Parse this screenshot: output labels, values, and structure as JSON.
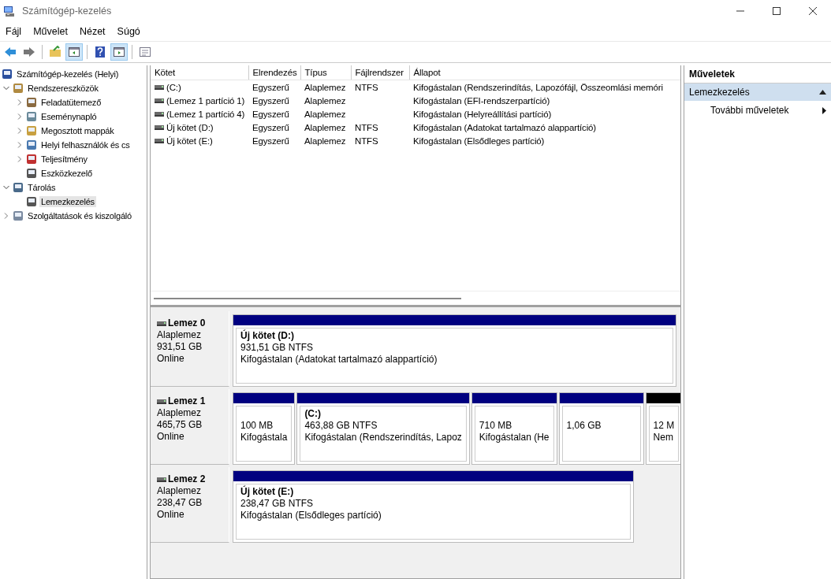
{
  "window": {
    "title": "Számítógép-kezelés"
  },
  "menu": [
    "Fájl",
    "Művelet",
    "Nézet",
    "Súgó"
  ],
  "toolbar": [
    {
      "kind": "back",
      "pressed": false
    },
    {
      "kind": "forward",
      "pressed": false
    },
    {
      "kind": "up",
      "pressed": false
    },
    {
      "kind": "tree",
      "pressed": true
    },
    {
      "kind": "help",
      "pressed": false
    },
    {
      "kind": "actions",
      "pressed": true
    },
    {
      "kind": "properties",
      "pressed": false
    }
  ],
  "tree": [
    {
      "label": "Számítógép-kezelés (Helyi)",
      "kind": "root",
      "selected": false,
      "children": [
        {
          "label": "Rendszereszközök",
          "kind": "folder",
          "expanded": true,
          "selected": false,
          "children": [
            {
              "label": "Feladatütemező",
              "kind": "folder",
              "expanded": false,
              "selected": false
            },
            {
              "label": "Eseménynapló",
              "kind": "folder",
              "expanded": false,
              "selected": false
            },
            {
              "label": "Megosztott mappák",
              "kind": "folder",
              "expanded": false,
              "selected": false
            },
            {
              "label": "Helyi felhasználók és cs",
              "kind": "folder",
              "expanded": false,
              "selected": false
            },
            {
              "label": "Teljesítmény",
              "kind": "folder",
              "expanded": false,
              "selected": false
            },
            {
              "label": "Eszközkezelő",
              "kind": "leaf",
              "selected": false
            }
          ]
        },
        {
          "label": "Tárolás",
          "kind": "folder",
          "expanded": true,
          "selected": false,
          "children": [
            {
              "label": "Lemezkezelés",
              "kind": "leaf",
              "selected": true
            }
          ]
        },
        {
          "label": "Szolgáltatások és kiszolgáló",
          "kind": "folder",
          "expanded": false,
          "selected": false
        }
      ]
    }
  ],
  "volumes": {
    "columns": [
      "Kötet",
      "Elrendezés",
      "Típus",
      "Fájlrendszer",
      "Állapot"
    ],
    "rows": [
      {
        "volume": " (C:)",
        "layout": "Egyszerű",
        "type": "Alaplemez",
        "filesystem": "NTFS",
        "status": "Kifogástalan (Rendszerindítás, Lapozófájl, Összeomlási memóri"
      },
      {
        "volume": "(Lemez 1 partíció 1)",
        "layout": "Egyszerű",
        "type": "Alaplemez",
        "status": "Kifogástalan (EFI-rendszerpartíció)"
      },
      {
        "volume": "(Lemez 1 partíció 4)",
        "layout": "Egyszerű",
        "type": "Alaplemez",
        "status": "Kifogástalan (Helyreállítási partíció)"
      },
      {
        "volume": "Új kötet (D:)",
        "layout": "Egyszerű",
        "type": "Alaplemez",
        "filesystem": "NTFS",
        "status": "Kifogástalan (Adatokat tartalmazó alappartíció)"
      },
      {
        "volume": "Új kötet (E:)",
        "layout": "Egyszerű",
        "type": "Alaplemez",
        "filesystem": "NTFS",
        "status": "Kifogástalan (Elsődleges partíció)"
      }
    ]
  },
  "disks": [
    {
      "name": "Lemez 0",
      "type": "Alaplemez",
      "size": "931,51 GB",
      "status": "Online",
      "partitions": [
        {
          "kind": "primary",
          "title": "Új kötet  (D:)",
          "size": "931,51 GB NTFS",
          "status": "Kifogástalan (Adatokat tartalmazó alappartíció)"
        }
      ]
    },
    {
      "name": "Lemez 1",
      "type": "Alaplemez",
      "size": "465,75 GB",
      "status": "Online",
      "partitions": [
        {
          "kind": "primary",
          "size": "100 MB",
          "status": "Kifogástala"
        },
        {
          "kind": "primary",
          "title": " (C:)",
          "size": "463,88 GB NTFS",
          "status": "Kifogástalan (Rendszerindítás, Lapoz"
        },
        {
          "kind": "primary",
          "size": "710 MB",
          "status": "Kifogástalan (He"
        },
        {
          "kind": "primary",
          "size": "1,06 GB"
        },
        {
          "kind": "unallocated",
          "size": "12 M",
          "status": "Nem"
        }
      ]
    },
    {
      "name": "Lemez 2",
      "type": "Alaplemez",
      "size": "238,47 GB",
      "status": "Online",
      "partitions": [
        {
          "kind": "primary",
          "title": "Új kötet  (E:)",
          "size": "238,47 GB NTFS",
          "status": "Kifogástalan (Elsődleges partíció)"
        }
      ]
    }
  ],
  "actions": {
    "title": "Műveletek",
    "sections": [
      {
        "label": "Lemezkezelés",
        "expanded": true,
        "items": [
          "További műveletek"
        ]
      }
    ]
  }
}
